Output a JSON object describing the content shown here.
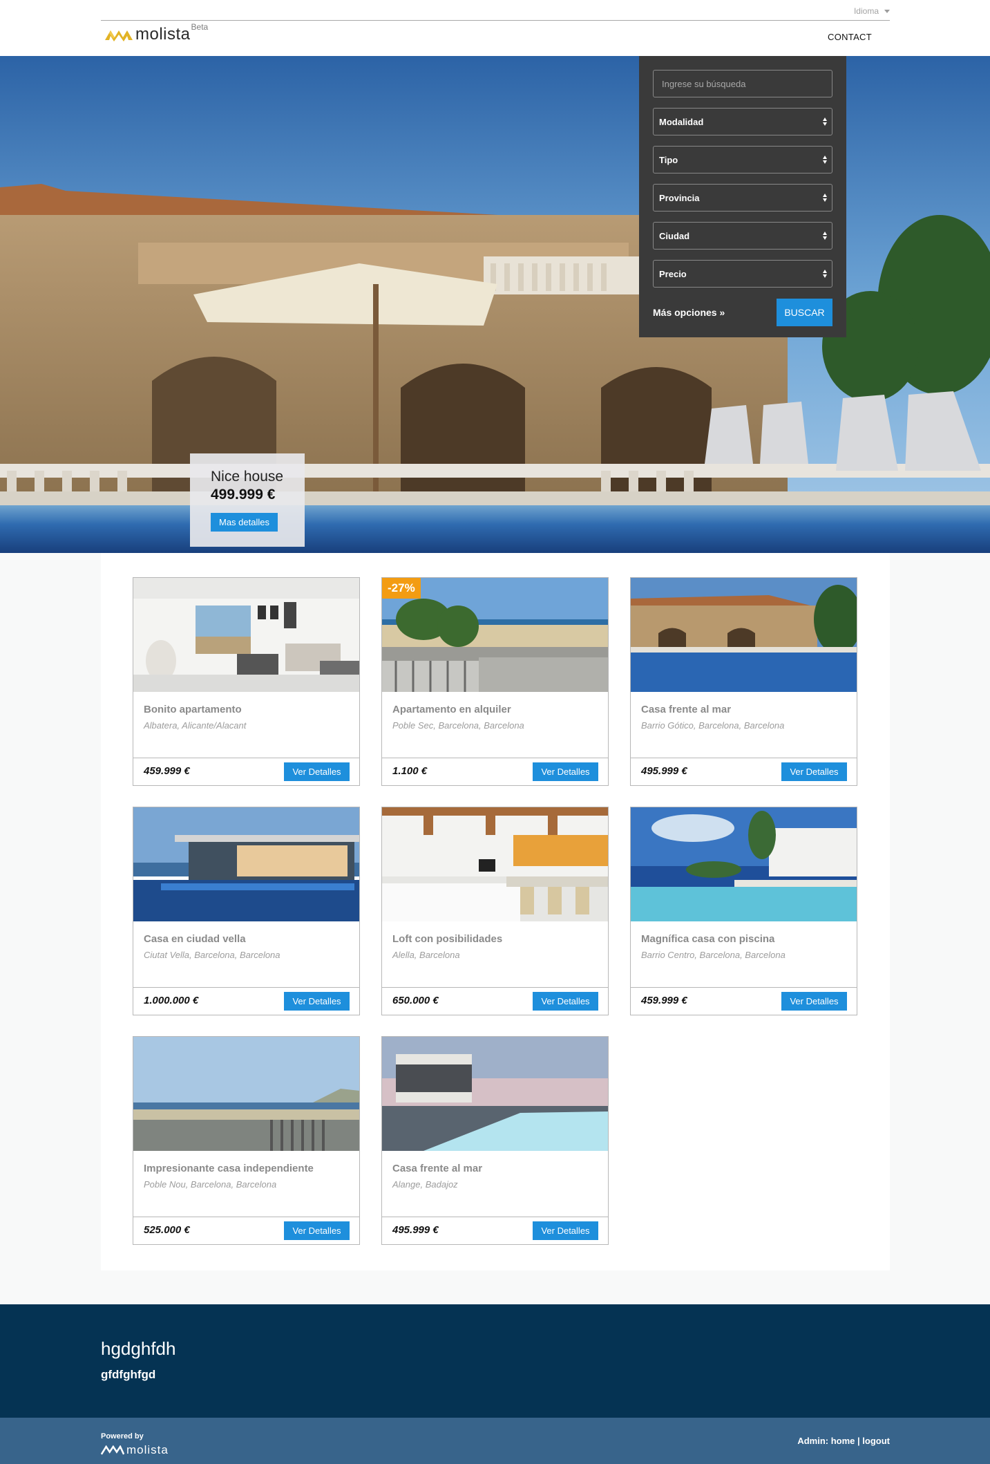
{
  "header": {
    "language_label": "Idioma",
    "logo_text": "molista",
    "logo_badge": "Beta",
    "nav": {
      "contact_label": "CONTACT"
    }
  },
  "search": {
    "placeholder": "Ingrese su búsqueda",
    "selects": [
      {
        "label": "Modalidad"
      },
      {
        "label": "Tipo"
      },
      {
        "label": "Provincia"
      },
      {
        "label": "Ciudad"
      },
      {
        "label": "Precio"
      }
    ],
    "more_options_label": "Más opciones »",
    "submit_label": "BUSCAR"
  },
  "featured": {
    "title": "Nice house",
    "price": "499.999 €",
    "button_label": "Mas detalles"
  },
  "listings": [
    {
      "title": "Bonito apartamento",
      "location": "Albatera, Alicante/Alacant",
      "price": "459.999 €",
      "button": "Ver Detalles",
      "badge": "",
      "image": "interior-living-room"
    },
    {
      "title": "Apartamento en alquiler",
      "location": "Poble Sec, Barcelona, Barcelona",
      "price": "1.100 €",
      "button": "Ver Detalles",
      "badge": "-27%",
      "image": "beach-view"
    },
    {
      "title": "Casa frente al mar",
      "location": "Barrio Gótico, Barcelona, Barcelona",
      "price": "495.999 €",
      "button": "Ver Detalles",
      "badge": "",
      "image": "villa-pool"
    },
    {
      "title": "Casa en ciudad vella",
      "location": "Ciutat Vella, Barcelona, Barcelona",
      "price": "1.000.000 €",
      "button": "Ver Detalles",
      "badge": "",
      "image": "modern-glass-house"
    },
    {
      "title": "Loft con posibilidades",
      "location": "Alella, Barcelona",
      "price": "650.000 €",
      "button": "Ver Detalles",
      "badge": "",
      "image": "kitchen"
    },
    {
      "title": "Magnífica casa con piscina",
      "location": "Barrio Centro, Barcelona, Barcelona",
      "price": "459.999 €",
      "button": "Ver Detalles",
      "badge": "",
      "image": "infinity-pool"
    },
    {
      "title": "Impresionante casa independiente",
      "location": "Poble Nou, Barcelona, Barcelona",
      "price": "525.000 €",
      "button": "Ver Detalles",
      "badge": "",
      "image": "sea-balcony"
    },
    {
      "title": "Casa frente al mar",
      "location": "Alange, Badajoz",
      "price": "495.999 €",
      "button": "Ver Detalles",
      "badge": "",
      "image": "sunset-pool-house"
    }
  ],
  "footer": {
    "title": "hgdghfdh",
    "subtitle": "gfdfghfgd",
    "powered_by": "Powered by",
    "logo_text": "molista",
    "admin_label": "Admin:",
    "home_link": "home",
    "separator": "|",
    "logout_link": "logout"
  },
  "colors": {
    "accent": "#1e8fdc",
    "badge": "#f39c12",
    "footer_dark": "#053353",
    "footer_light": "#38648b",
    "panel": "#3a3a3a"
  }
}
